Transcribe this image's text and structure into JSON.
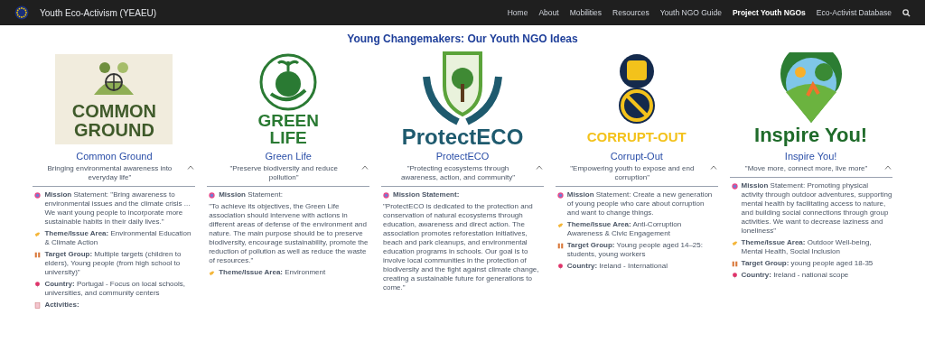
{
  "site": {
    "title": "Youth Eco-Activism (YEAEU)"
  },
  "nav": [
    {
      "label": "Home",
      "selected": false
    },
    {
      "label": "About",
      "selected": false
    },
    {
      "label": "Mobilities",
      "selected": false
    },
    {
      "label": "Resources",
      "selected": false
    },
    {
      "label": "Youth NGO Guide",
      "selected": false
    },
    {
      "label": "Project Youth NGOs",
      "selected": true
    },
    {
      "label": "Eco-Activist Database",
      "selected": false
    }
  ],
  "heading": "Young Changemakers: Our Youth NGO Ideas",
  "ngos": [
    {
      "kind": "common",
      "logo_text": [
        "COMMON",
        "GROUND"
      ],
      "name": "Common Ground",
      "tagline": "Bringing environmental awareness into everyday life\"",
      "expanded": true,
      "fields": [
        {
          "kind": "mission",
          "text": "**Mission** Statement: \"Bring awareness to environmental issues and the climate crisis ... We want young people to incorporate more sustainable habits in their daily lives.\""
        },
        {
          "kind": "theme",
          "text": "**Theme/Issue Area:** Environmental Education & Climate Action"
        },
        {
          "kind": "target",
          "text": "**Target Group:** Multiple targets (children to elders), Young people (from high school to university)\""
        },
        {
          "kind": "country",
          "text": "**Country:** Portugal - Focus on local schools, universities, and community centers"
        },
        {
          "kind": "activities",
          "text": "**Activities:**"
        }
      ]
    },
    {
      "kind": "green",
      "logo_text": [
        "GREEN",
        "LIFE"
      ],
      "name": "Green Life",
      "tagline": "\"Preserve biodiversity and reduce pollution\"",
      "expanded": true,
      "fields": [
        {
          "kind": "mission",
          "text": "**Mission** Statement:"
        },
        {
          "kind": "paragraph",
          "text": "\"To achieve its objectives, the Green Life association should intervene with actions in different areas of defense of the environment and nature. The main purpose should be to preserve biodiversity, encourage sustainability, promote the reduction of pollution as well as reduce the waste of resources.\""
        },
        {
          "kind": "theme",
          "text": "**Theme/Issue Area:** Environment"
        }
      ]
    },
    {
      "kind": "protect",
      "logo_text": [
        "ProtectECO"
      ],
      "name": "ProtectECO",
      "tagline": "\"Protecting ecosystems through awareness, action, and community\"",
      "expanded": true,
      "fields": [
        {
          "kind": "mission",
          "text": "**Mission Statement:**"
        },
        {
          "kind": "paragraph",
          "text": "\"ProtectECO is dedicated to the protection and conservation of natural ecosystems through education, awareness and direct action. The association promotes reforestation initiatives, beach and park cleanups, and environmental education programs in schools. Our goal is to involve local communities in the protection of biodiversity and the fight against climate change, creating a sustainable future for generations to come.\""
        }
      ]
    },
    {
      "kind": "corrupt",
      "logo_text": [
        "CORRUPT-OUT"
      ],
      "name": "Corrupt-Out",
      "tagline": "\"Empowering youth to expose and end corruption\"",
      "expanded": true,
      "fields": [
        {
          "kind": "mission",
          "text": "**Mission** Statement: Create a new generation of young people who care about corruption and want to change things."
        },
        {
          "kind": "theme",
          "text": "**Theme/Issue Area:** Anti-Corruption Awareness & Civic Engagement"
        },
        {
          "kind": "target",
          "text": "**Target Group:** Young people aged 14–25: students, young workers"
        },
        {
          "kind": "country",
          "text": "**Country:** Ireland - International"
        }
      ]
    },
    {
      "kind": "inspire",
      "logo_text": [
        "Inspire You!"
      ],
      "name": "Inspire You!",
      "tagline": "\"Move more, connect more, live more\"",
      "expanded": true,
      "fields": [
        {
          "kind": "mission",
          "text": "**Mission** Statement: Promoting physical activity through outdoor adventures, supporting mental health by facilitating access to nature, and building social connections through group activities. We want to decrease laziness and loneliness\""
        },
        {
          "kind": "theme",
          "text": "**Theme/Issue Area:** Outdoor Well-being, Mental Health, Social Inclusion"
        },
        {
          "kind": "target",
          "text": "**Target Group:** young people aged 18-35"
        },
        {
          "kind": "country",
          "text": "**Country:** Ireland - national scope"
        }
      ]
    }
  ]
}
